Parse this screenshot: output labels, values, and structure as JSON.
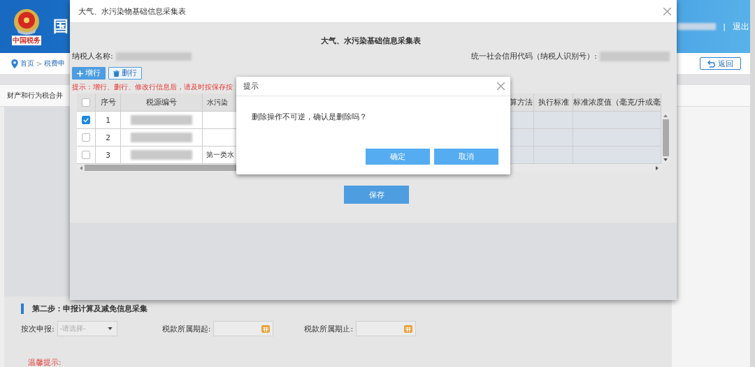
{
  "header": {
    "logo_caption": "中国税务",
    "site_title": "国",
    "separator": "|",
    "logout": "退出"
  },
  "breadcrumb": {
    "items": [
      "首页",
      "税费申"
    ],
    "separator": ">"
  },
  "back_button": "返回",
  "tab_label": "财产和行为税合并",
  "section": {
    "title": "第二步：申报计算及减免信息采集",
    "fields": [
      {
        "kind": "select",
        "label": "按次申报:",
        "placeholder": "-请选择-"
      },
      {
        "kind": "date",
        "label": "税款所属期起:"
      },
      {
        "kind": "date",
        "label": "税款所属期止:"
      }
    ],
    "notice_title": "温馨提示:"
  },
  "dialog": {
    "title": "大气、水污染物基础信息采集表",
    "form_title": "大气、水污染基础信息采集表",
    "taxpayer_name_label": "纳税人名称:",
    "credit_code_label": "统一社会信用代码（纳税人识别号）:",
    "buttons": [
      {
        "kind": "add",
        "label": "增行"
      },
      {
        "kind": "delete",
        "label": "删行"
      }
    ],
    "hint": "提示：增行、删行、修改行信息后，请及时按保存按",
    "table": {
      "header_checked": false,
      "columns": [
        {
          "label": "序号"
        },
        {
          "label": "税源编号"
        },
        {
          "label": "水污染"
        },
        {
          "label": "算方法"
        },
        {
          "label": "执行标准"
        },
        {
          "label": "标准浓度值（毫克/升或毫"
        }
      ],
      "rows": [
        {
          "checked": true,
          "no": "1"
        },
        {
          "checked": false,
          "no": "2"
        },
        {
          "checked": false,
          "no": "3",
          "pollutant": "第一类水"
        }
      ]
    },
    "save": "保存"
  },
  "confirm": {
    "title": "提示",
    "message": "删除操作不可逆，确认是删除吗？",
    "buttons": [
      {
        "label": "确定"
      },
      {
        "label": "取消"
      }
    ]
  }
}
